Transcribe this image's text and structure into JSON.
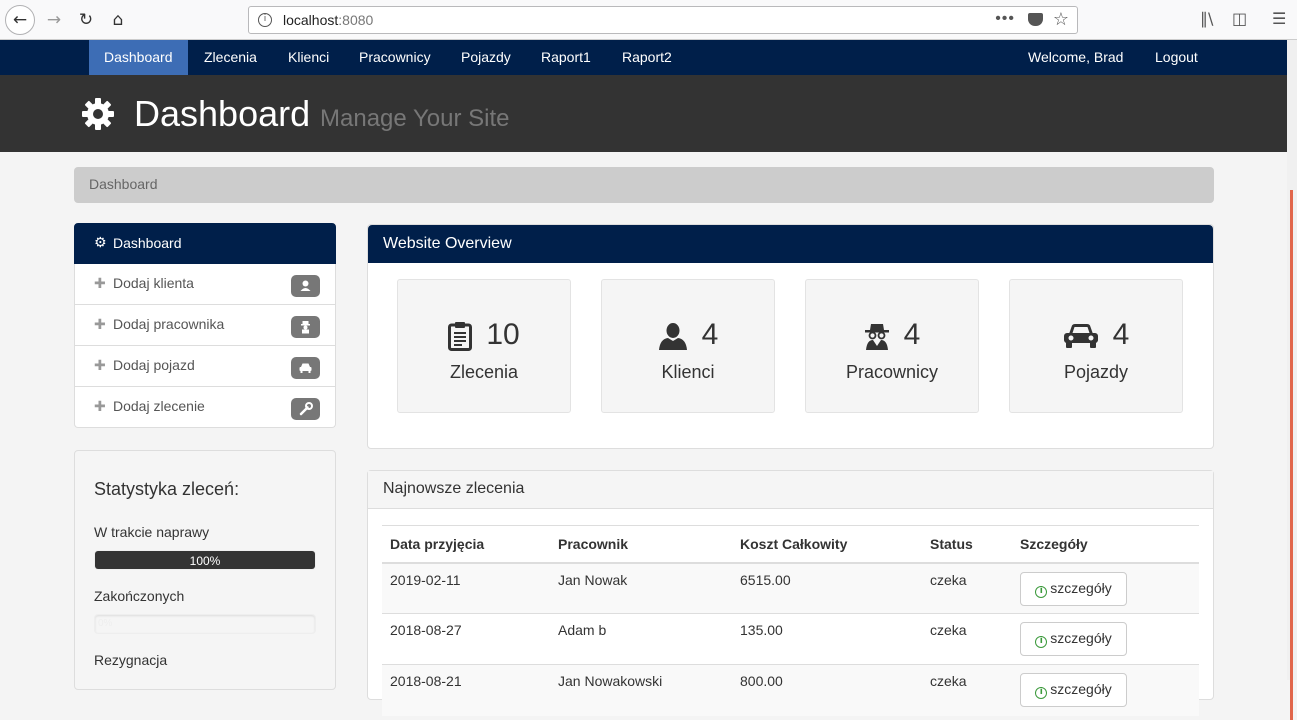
{
  "browser": {
    "url_host": "localhost",
    "url_port": ":8080"
  },
  "navbar": {
    "items": [
      "Dashboard",
      "Zlecenia",
      "Klienci",
      "Pracownicy",
      "Pojazdy",
      "Raport1",
      "Raport2"
    ],
    "active": "Dashboard",
    "welcome": "Welcome, Brad",
    "logout": "Logout"
  },
  "header": {
    "title": "Dashboard",
    "subtitle": "Manage Your Site"
  },
  "breadcrumb": "Dashboard",
  "sidebar": {
    "head": "Dashboard",
    "items": [
      {
        "label": "Dodaj klienta",
        "icon": "user-icon"
      },
      {
        "label": "Dodaj pracownika",
        "icon": "spy-icon"
      },
      {
        "label": "Dodaj pojazd",
        "icon": "car-icon"
      },
      {
        "label": "Dodaj zlecenie",
        "icon": "wrench-icon"
      }
    ]
  },
  "stats": {
    "title": "Statystyka zleceń:",
    "bars": [
      {
        "label": "W trakcie naprawy",
        "value": 100,
        "text": "100%"
      },
      {
        "label": "Zakończonych",
        "value": 0,
        "text": "0%"
      },
      {
        "label": "Rezygnacja",
        "value": 0,
        "text": ""
      }
    ]
  },
  "overview": {
    "title": "Website Overview",
    "cards": [
      {
        "count": "10",
        "label": "Zlecenia",
        "icon": "clipboard-icon"
      },
      {
        "count": "4",
        "label": "Klienci",
        "icon": "user-icon"
      },
      {
        "count": "4",
        "label": "Pracownicy",
        "icon": "spy-icon"
      },
      {
        "count": "4",
        "label": "Pojazdy",
        "icon": "car-icon"
      }
    ]
  },
  "orders": {
    "title": "Najnowsze zlecenia",
    "headers": [
      "Data przyjęcia",
      "Pracownik",
      "Koszt Całkowity",
      "Status",
      "Szczegóły"
    ],
    "rows": [
      [
        "2019-02-11",
        "Jan Nowak",
        "6515.00",
        "czeka"
      ],
      [
        "2018-08-27",
        "Adam b",
        "135.00",
        "czeka"
      ],
      [
        "2018-08-21",
        "Jan Nowakowski",
        "800.00",
        "czeka"
      ]
    ],
    "details_label": "szczegóły"
  },
  "colors": {
    "navbar": "#001f4a",
    "active_nav": "#3d6db5",
    "header": "#333333"
  }
}
